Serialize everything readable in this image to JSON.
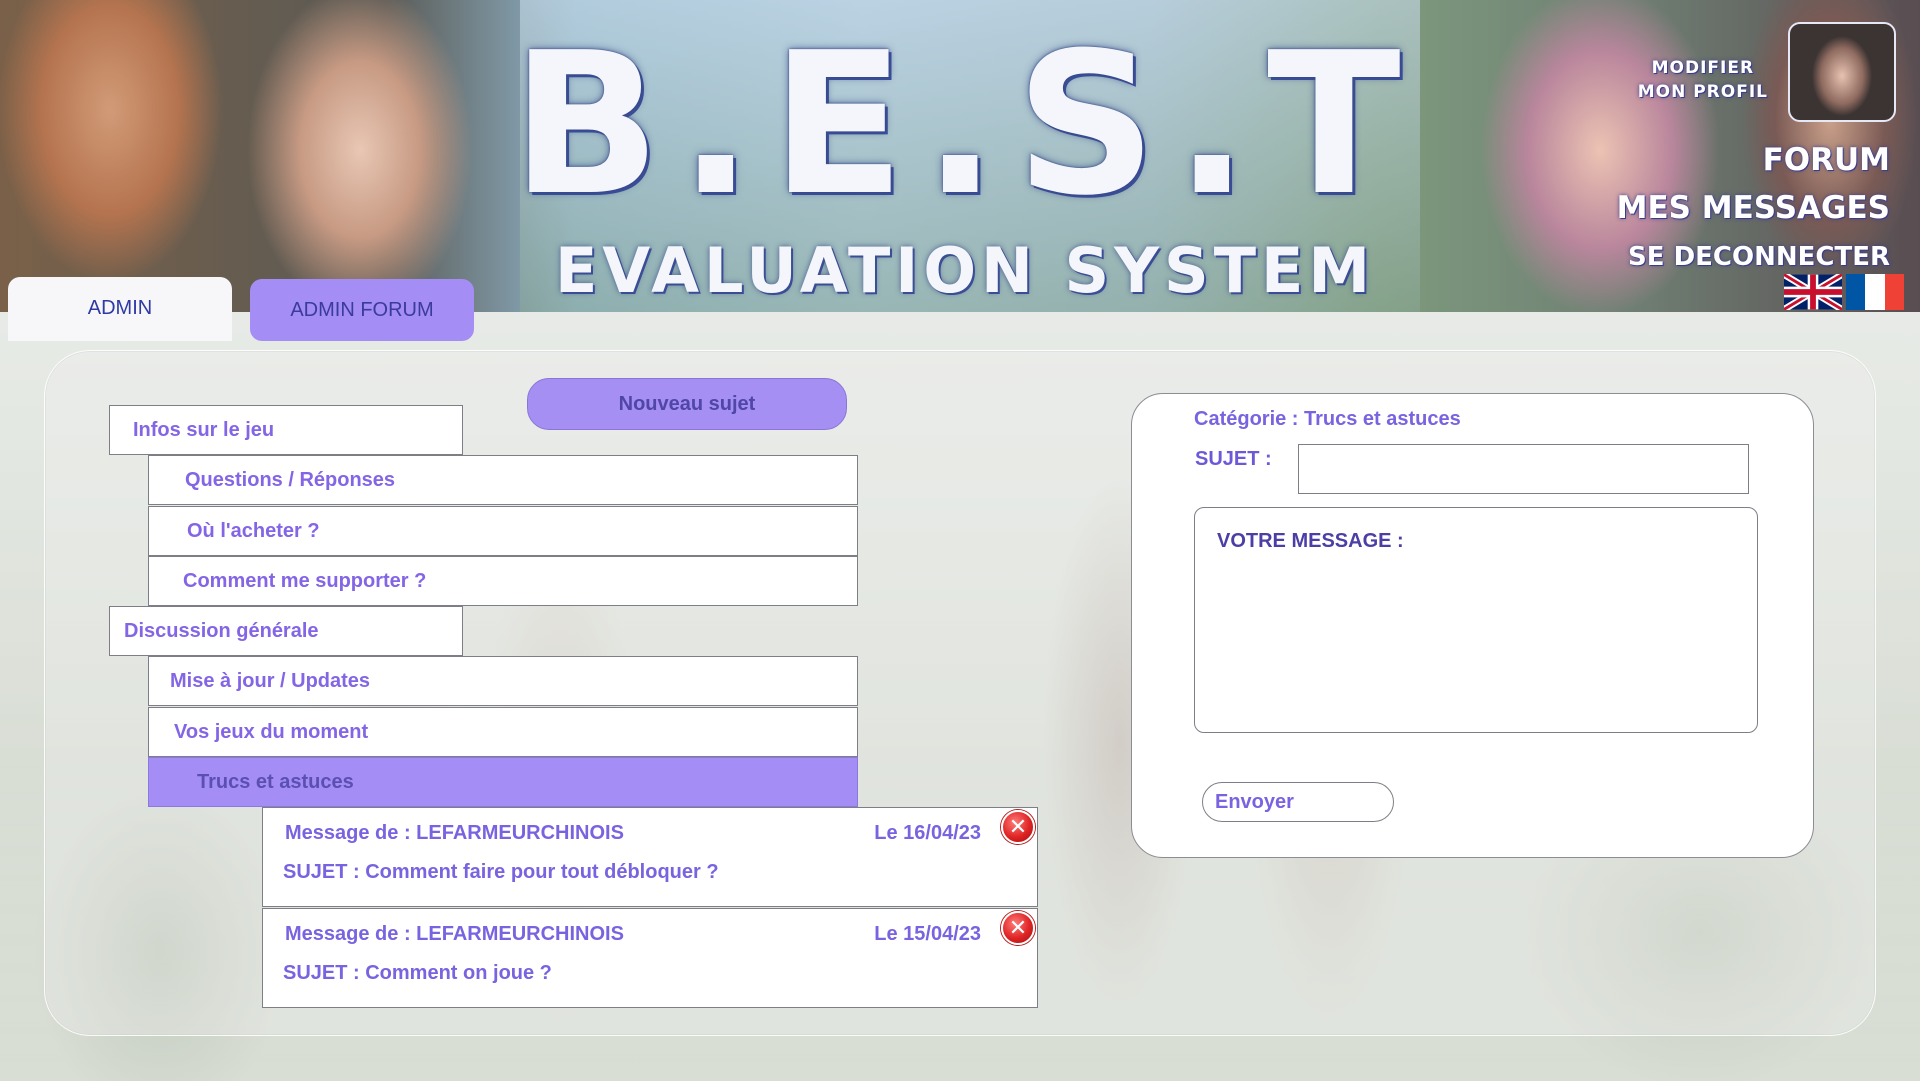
{
  "header": {
    "logo_title": "B.E.S.T",
    "logo_subtitle": "EVALUATION SYSTEM",
    "modify_profile_line1": "MODIFIER",
    "modify_profile_line2": "MON PROFIL",
    "forum": "FORUM",
    "my_messages": "MES MESSAGES",
    "logout": "SE DECONNECTER",
    "languages": [
      "en",
      "fr"
    ]
  },
  "tabs": {
    "admin": "ADMIN",
    "admin_forum": "ADMIN FORUM"
  },
  "forum": {
    "new_topic": "Nouveau sujet",
    "categories": [
      {
        "label": "Infos sur le jeu",
        "subcategories": [
          "Questions / Réponses",
          "Où l'acheter ?",
          "Comment me supporter ?"
        ]
      },
      {
        "label": "Discussion générale",
        "subcategories": [
          "Mise à jour / Updates",
          "Vos jeux du moment",
          "Trucs et astuces"
        ]
      }
    ],
    "active_subcategory": "Trucs et astuces",
    "messages": [
      {
        "from": "Message de  : LEFARMEURCHINOIS",
        "date": "Le 16/04/23",
        "subject": "SUJET : Comment faire pour tout débloquer ?"
      },
      {
        "from": "Message de  : LEFARMEURCHINOIS",
        "date": "Le 15/04/23",
        "subject": "SUJET : Comment on joue ?"
      }
    ]
  },
  "compose": {
    "category": "Catégorie : Trucs et astuces",
    "subject_label": "SUJET :",
    "subject_value": "",
    "message_placeholder": "VOTRE MESSAGE :",
    "send": "Envoyer"
  },
  "colors": {
    "accent_purple": "#a58df6",
    "text_purple": "#7a63e0",
    "tab_text_blue": "#2e3aa5",
    "delete_red": "#e02424"
  },
  "icons": {
    "delete": "close-circle-icon",
    "flag_uk": "uk-flag-icon",
    "flag_fr": "fr-flag-icon"
  }
}
